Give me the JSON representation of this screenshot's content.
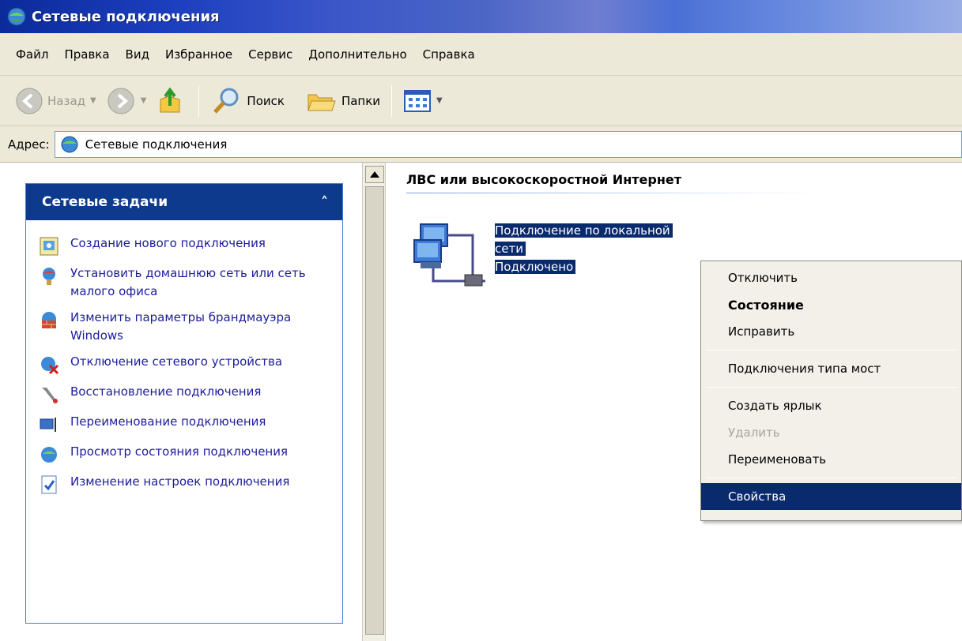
{
  "window": {
    "title": "Сетевые подключения"
  },
  "menu": [
    "Файл",
    "Правка",
    "Вид",
    "Избранное",
    "Сервис",
    "Дополнительно",
    "Справка"
  ],
  "toolbar": {
    "back_label": "Назад",
    "search_label": "Поиск",
    "folders_label": "Папки"
  },
  "address": {
    "label": "Адрес:",
    "value": "Сетевые подключения"
  },
  "task_panel": {
    "title": "Сетевые задачи",
    "collapse_glyph": "˄",
    "items": [
      {
        "label": "Создание нового подключения",
        "icon": "new-connection-icon"
      },
      {
        "label": "Установить домашнюю сеть или сеть малого офиса",
        "icon": "home-network-icon"
      },
      {
        "label": "Изменить параметры брандмауэра Windows",
        "icon": "firewall-icon"
      },
      {
        "label": "Отключение сетевого устройства",
        "icon": "disable-device-icon"
      },
      {
        "label": "Восстановление подключения",
        "icon": "repair-icon"
      },
      {
        "label": "Переименование подключения",
        "icon": "rename-icon"
      },
      {
        "label": "Просмотр состояния подключения",
        "icon": "status-icon"
      },
      {
        "label": "Изменение настроек подключения",
        "icon": "settings-icon"
      }
    ]
  },
  "content": {
    "group_title": "ЛВС или высокоскоростной Интернет",
    "connection": {
      "name_line1": "Подключение по локальной",
      "name_line2": "сети",
      "status": "Подключено"
    }
  },
  "context_menu": {
    "items": [
      {
        "label": "Отключить",
        "style": "normal"
      },
      {
        "label": "Состояние",
        "style": "bold"
      },
      {
        "label": "Исправить",
        "style": "normal"
      },
      {
        "label": "Подключения типа мост",
        "style": "normal"
      },
      {
        "label": "Создать ярлык",
        "style": "normal"
      },
      {
        "label": "Удалить",
        "style": "disabled"
      },
      {
        "label": "Переименовать",
        "style": "normal"
      },
      {
        "label": "Свойства",
        "style": "selected"
      }
    ]
  },
  "colors": {
    "selection": "#0a2a6e",
    "task_header": "#0d3a8c",
    "link": "#1c1c9c",
    "chrome": "#ece9d8"
  }
}
